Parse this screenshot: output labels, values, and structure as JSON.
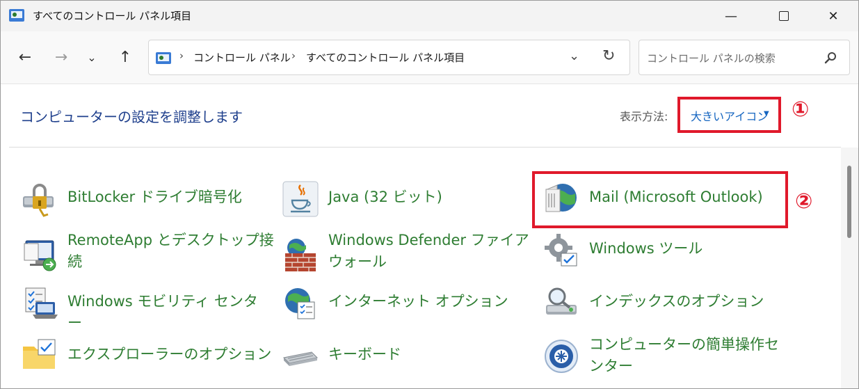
{
  "window": {
    "title": "すべてのコントロール パネル項目",
    "minimize": "—",
    "close": "✕"
  },
  "nav": {
    "back": "←",
    "forward": "→",
    "recent": "⌄",
    "up": "↑",
    "breadcrumb": [
      "コントロール パネル",
      "すべてのコントロール パネル項目"
    ],
    "separator": "›",
    "dropdown": "⌄",
    "refresh": "↻",
    "search_placeholder": "コントロール パネルの検索"
  },
  "header": {
    "title": "コンピューターの設定を調整します",
    "view_label": "表示方法:",
    "view_value": "大きいアイコン",
    "view_caret": "▼"
  },
  "annotations": {
    "one": "①",
    "two": "②",
    "color": "#e0192b"
  },
  "items": [
    {
      "label": "BitLocker ドライブ暗号化",
      "icon": "bitlocker-icon"
    },
    {
      "label": "Java (32 ビット)",
      "icon": "java-icon"
    },
    {
      "label": "Mail (Microsoft Outlook)",
      "icon": "mail-icon"
    },
    {
      "label": "RemoteApp とデスクトップ接続",
      "icon": "remoteapp-icon"
    },
    {
      "label": "Windows Defender ファイアウォール",
      "icon": "firewall-icon"
    },
    {
      "label": "Windows ツール",
      "icon": "tools-icon"
    },
    {
      "label": "Windows モビリティ センター",
      "icon": "mobility-icon"
    },
    {
      "label": "インターネット オプション",
      "icon": "internet-options-icon"
    },
    {
      "label": "インデックスのオプション",
      "icon": "indexing-icon"
    },
    {
      "label": "エクスプローラーのオプション",
      "icon": "folder-options-icon"
    },
    {
      "label": "キーボード",
      "icon": "keyboard-icon"
    },
    {
      "label": "コンピューターの簡単操作センター",
      "icon": "ease-of-access-icon"
    }
  ],
  "colors": {
    "title": "#1e3f8c",
    "link": "#2e7d32",
    "accent": "#1565c0"
  }
}
